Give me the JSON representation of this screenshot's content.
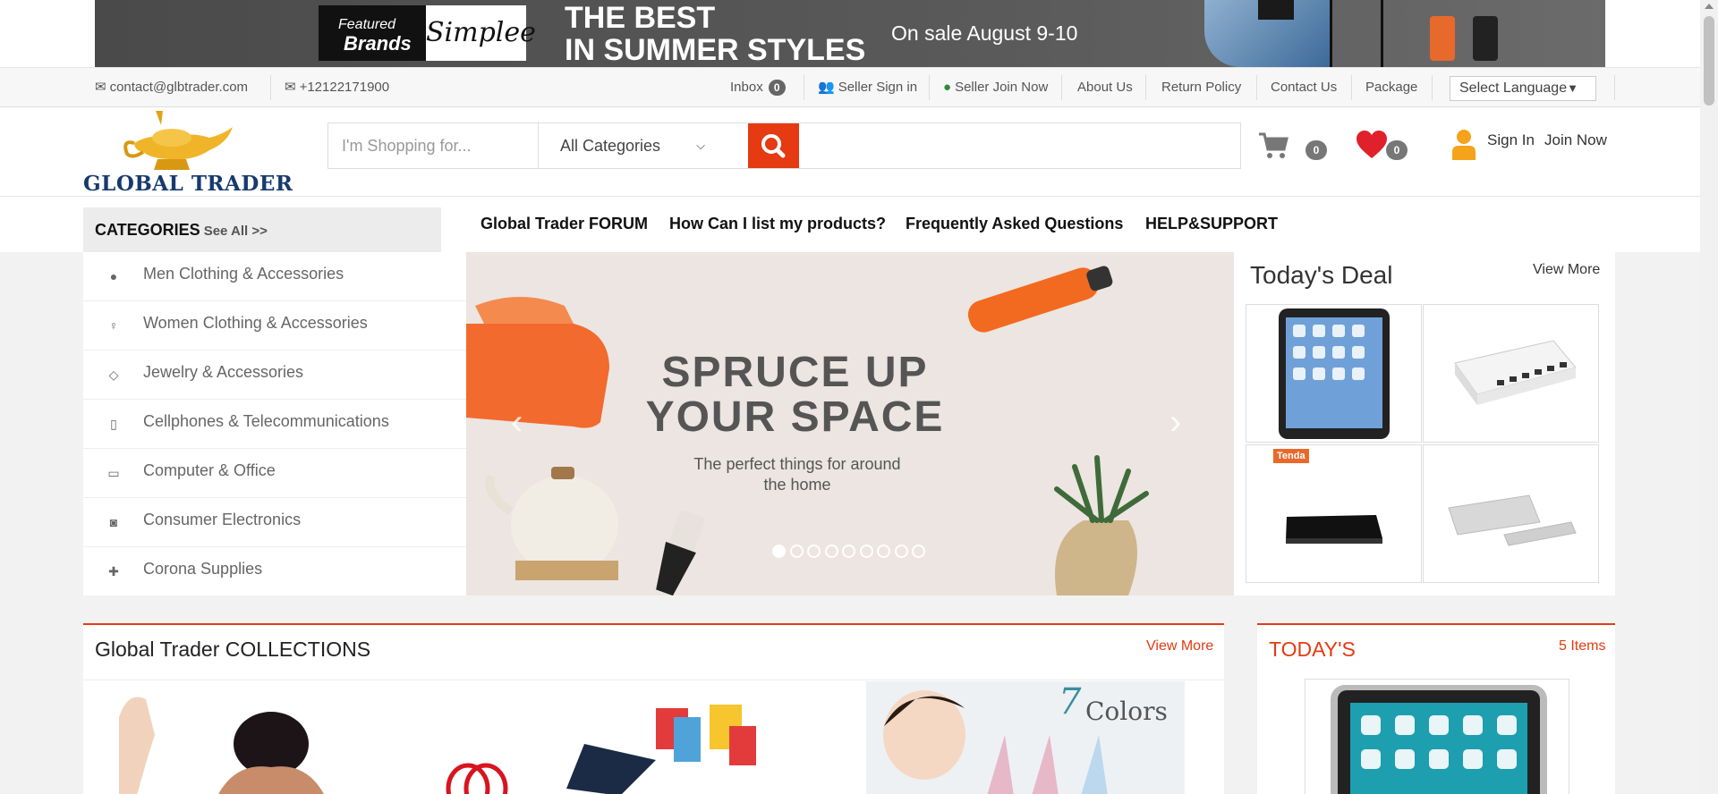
{
  "banner": {
    "featured_line1": "Featured",
    "featured_line2": "Brands",
    "brand": "Simplee",
    "headline_line1": "THE BEST",
    "headline_line2": "IN SUMMER STYLES",
    "sale_text": "On sale August 9-10"
  },
  "infobar": {
    "email": "contact@glbtrader.com",
    "phone": "+12122171900",
    "inbox_label": "Inbox",
    "inbox_count": "0",
    "seller_signin": "Seller Sign in",
    "seller_join": "Seller Join Now",
    "about": "About Us",
    "return_policy": "Return Policy",
    "contact": "Contact Us",
    "package": "Package",
    "language": "Select Language"
  },
  "header": {
    "logo_text": "GLOBAL TRADER",
    "search_placeholder": "I'm Shopping for...",
    "category_selected": "All Categories",
    "cart_count": "0",
    "wishlist_count": "0",
    "sign_in": "Sign In",
    "join_now": "Join Now"
  },
  "nav": {
    "categories_title": "CATEGORIES",
    "see_all": "See All >>",
    "links": [
      "Global Trader FORUM",
      "How Can I list my products?",
      "Frequently Asked Questions",
      "HELP&SUPPORT"
    ]
  },
  "categories": [
    {
      "label": "Men Clothing & Accessories",
      "icon": "user-icon"
    },
    {
      "label": "Women Clothing & Accessories",
      "icon": "woman-icon"
    },
    {
      "label": "Jewelry & Accessories",
      "icon": "diamond-icon"
    },
    {
      "label": "Cellphones & Telecommunications",
      "icon": "mobile-icon"
    },
    {
      "label": "Computer & Office",
      "icon": "desktop-icon"
    },
    {
      "label": "Consumer Electronics",
      "icon": "camera-icon"
    },
    {
      "label": "Corona Supplies",
      "icon": "ambulance-icon"
    }
  ],
  "slider": {
    "headline_line1": "SPRUCE UP",
    "headline_line2": "YOUR SPACE",
    "subtitle_line1": "The perfect things for around",
    "subtitle_line2": "the home",
    "slide_count": 9,
    "active_slide": 1
  },
  "deal": {
    "title": "Today's Deal",
    "view_more": "View More",
    "tenda_label": "Tenda"
  },
  "collections": {
    "title": "Global Trader COLLECTIONS",
    "view_more": "View More",
    "colors_number": "7",
    "colors_label": "Colors"
  },
  "todays": {
    "title": "TODAY'S",
    "count": "5 Items"
  },
  "colors": {
    "accent": "#e53a12",
    "logo_navy": "#173a6e",
    "heart": "#e0202a",
    "user_orange": "#f5a31a"
  }
}
